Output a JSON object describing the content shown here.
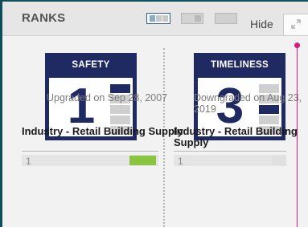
{
  "header": {
    "title": "RANKS",
    "hide_label": "Hide",
    "view_icons": [
      "three-column-view-icon",
      "two-column-view-icon",
      "single-column-view-icon"
    ]
  },
  "cards": [
    {
      "label": "SAFETY",
      "rank": "1",
      "active_segment": 1,
      "note": "Upgraded on Sep 28, 2007",
      "industry": "Industry - Retail Building Supply",
      "industry_rank": "1",
      "industry_bar_color": "#8bc53f"
    },
    {
      "label": "TIMELINESS",
      "rank": "3",
      "active_segment": 3,
      "note": "Downgraded on Aug 23, 2019",
      "industry": "Industry - Retail Building Supply",
      "industry_rank": "1",
      "industry_bar_color": "#e0e0e0"
    }
  ],
  "colors": {
    "badge_navy": "#1f2a63",
    "accent_teal": "#0e4f5c",
    "pointer_magenta": "#d6197a"
  }
}
